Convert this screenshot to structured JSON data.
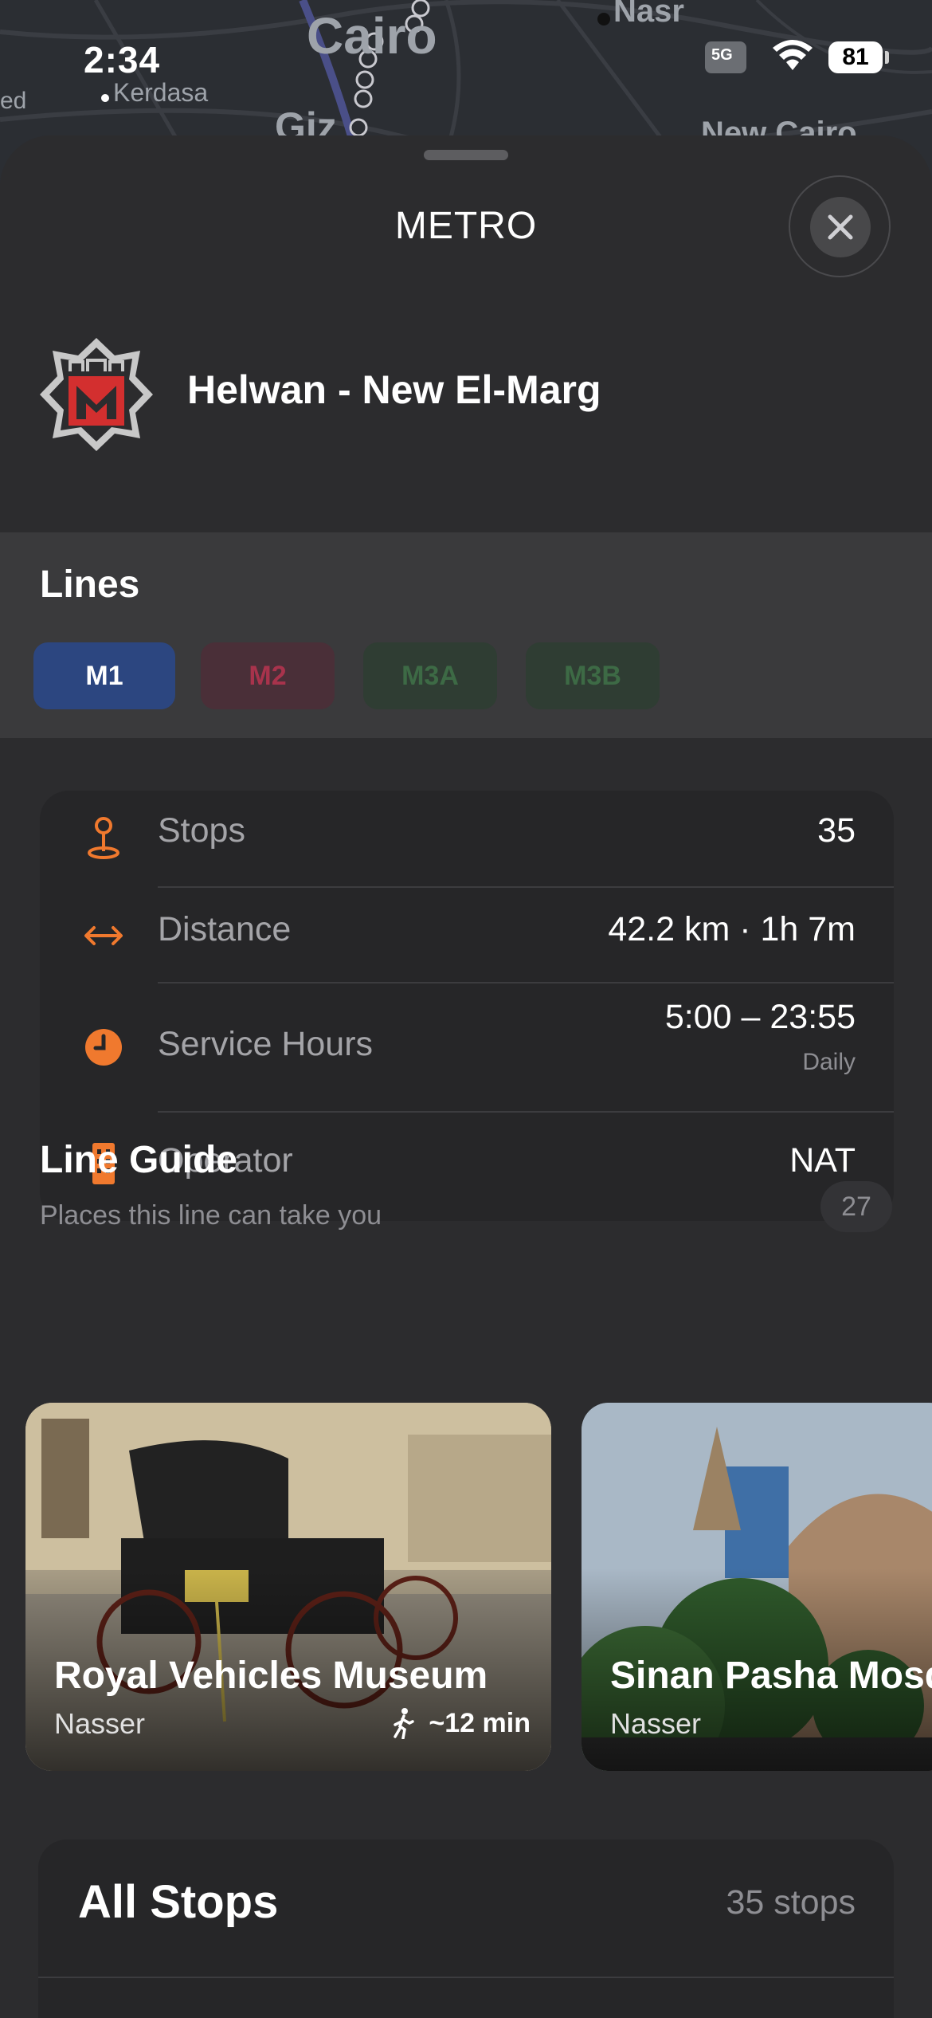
{
  "status_bar": {
    "time": "2:34",
    "signal": "5G",
    "battery": "81"
  },
  "map": {
    "labels": [
      "Cairo",
      "Nasr",
      "Kerdasa",
      "Giz",
      "New Cairo",
      "ed"
    ]
  },
  "sheet": {
    "title": "METRO",
    "route_name": "Helwan - New El-Marg"
  },
  "lines": {
    "title": "Lines",
    "chips": [
      {
        "label": "M1",
        "color": "#2c4680",
        "text_color": "#ffffff"
      },
      {
        "label": "M2",
        "color": "#4a2f38",
        "text_color": "#a8334c"
      },
      {
        "label": "M3A",
        "color": "#2f3d33",
        "text_color": "#3d6a45"
      },
      {
        "label": "M3B",
        "color": "#2f3d33",
        "text_color": "#3d6a45"
      }
    ]
  },
  "info": {
    "stops_label": "Stops",
    "stops_value": "35",
    "distance_label": "Distance",
    "distance_value": "42.2 km · 1h 7m",
    "hours_label": "Service Hours",
    "hours_value": "5:00 – 23:55",
    "hours_sub": "Daily",
    "operator_label": "Operator",
    "operator_value": "NAT",
    "accent": "#f0792e"
  },
  "guide": {
    "title": "Line Guide",
    "subtitle": "Places this line can take you",
    "count": "27",
    "cards": [
      {
        "name": "Royal Vehicles Museum",
        "area": "Nasser",
        "walk": "~12 min"
      },
      {
        "name": "Sinan Pasha Mosque",
        "area": "Nasser"
      }
    ]
  },
  "all_stops": {
    "title": "All Stops",
    "count": "35 stops"
  }
}
